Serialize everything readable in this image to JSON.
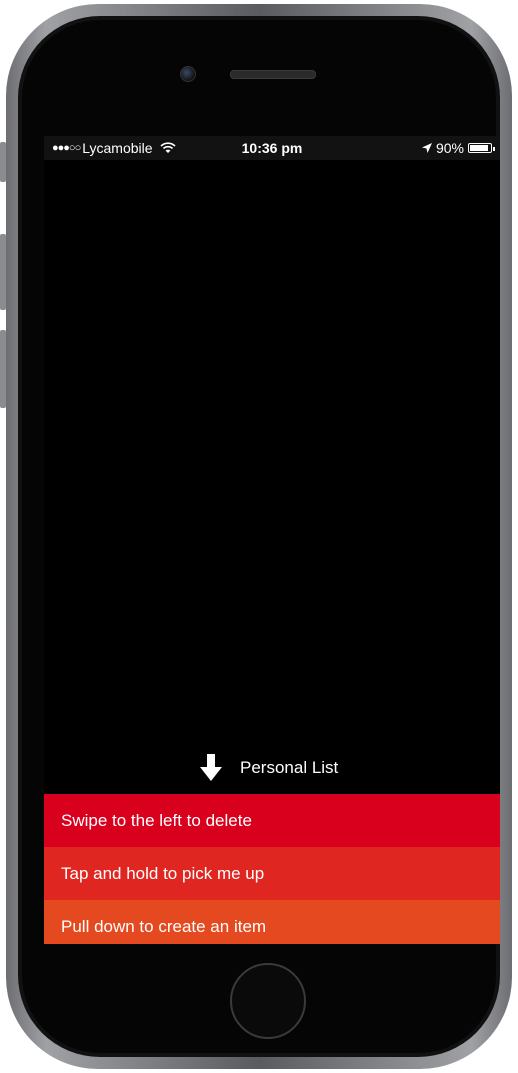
{
  "status_bar": {
    "carrier": "Lycamobile",
    "signal_dots": "●●●○○",
    "time": "10:36 pm",
    "battery": "90%",
    "battery_level": 0.9
  },
  "list": {
    "title": "Personal List",
    "items": [
      {
        "label": "Swipe to the left to delete",
        "color": "#d9001e"
      },
      {
        "label": "Tap and hold to pick me up",
        "color": "#e02620"
      },
      {
        "label": "Pull down to create an item",
        "color": "#e4491f"
      }
    ]
  }
}
